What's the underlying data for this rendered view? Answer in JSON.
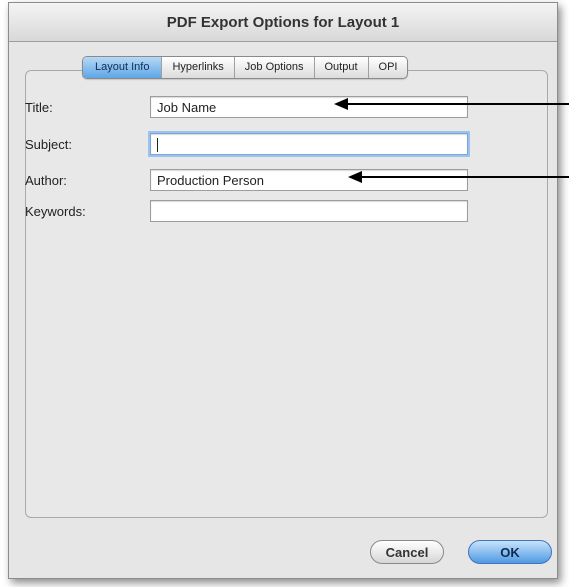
{
  "window": {
    "title": "PDF Export Options for Layout 1"
  },
  "tabs": [
    {
      "label": "Layout Info",
      "active": true
    },
    {
      "label": "Hyperlinks",
      "active": false
    },
    {
      "label": "Job Options",
      "active": false
    },
    {
      "label": "Output",
      "active": false
    },
    {
      "label": "OPI",
      "active": false
    }
  ],
  "fields": {
    "title": {
      "label": "Title:",
      "value": "Job Name"
    },
    "subject": {
      "label": "Subject:",
      "value": ""
    },
    "author": {
      "label": "Author:",
      "value": "Production Person"
    },
    "keywords": {
      "label": "Keywords:",
      "value": ""
    }
  },
  "buttons": {
    "cancel": "Cancel",
    "ok": "OK"
  },
  "colors": {
    "accent": "#5ea6e6",
    "dialog_bg": "#e6e6e6",
    "annotation_arrow": "#000000"
  }
}
